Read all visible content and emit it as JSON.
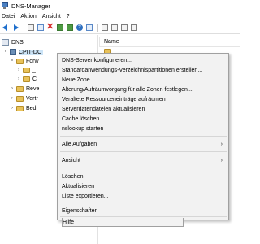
{
  "window": {
    "title": "DNS-Manager"
  },
  "menubar": {
    "items": [
      "Datei",
      "Aktion",
      "Ansicht",
      "?"
    ]
  },
  "tree": {
    "root": "DNS",
    "server": "CPIT-DC",
    "nodes": [
      "Forw",
      "_",
      "C",
      "Reve",
      "Vertr",
      "Bedi"
    ]
  },
  "list": {
    "column_header": "Name"
  },
  "context_menu": {
    "items": [
      "DNS-Server konfigurieren...",
      "Standardanwendungs-Verzeichnispartitionen erstellen...",
      "Neue Zone...",
      "Alterung/Aufräumvorgang für alle Zonen festlegen...",
      "Veraltete Ressourceneinträge aufräumen",
      "Serverdatendateien aktualisieren",
      "Cache löschen",
      "nslookup starten",
      "Alle Aufgaben",
      "Ansicht",
      "Löschen",
      "Aktualisieren",
      "Liste exportieren...",
      "Eigenschaften",
      "Hilfe"
    ],
    "submenu_arrow": "›"
  },
  "colors": {
    "selection": "#cce4f7",
    "menu_background": "#f2f2f2",
    "folder": "#e8c25a",
    "toolbar_arrow": "#1e6fcc",
    "delete_icon": "#d32626"
  }
}
